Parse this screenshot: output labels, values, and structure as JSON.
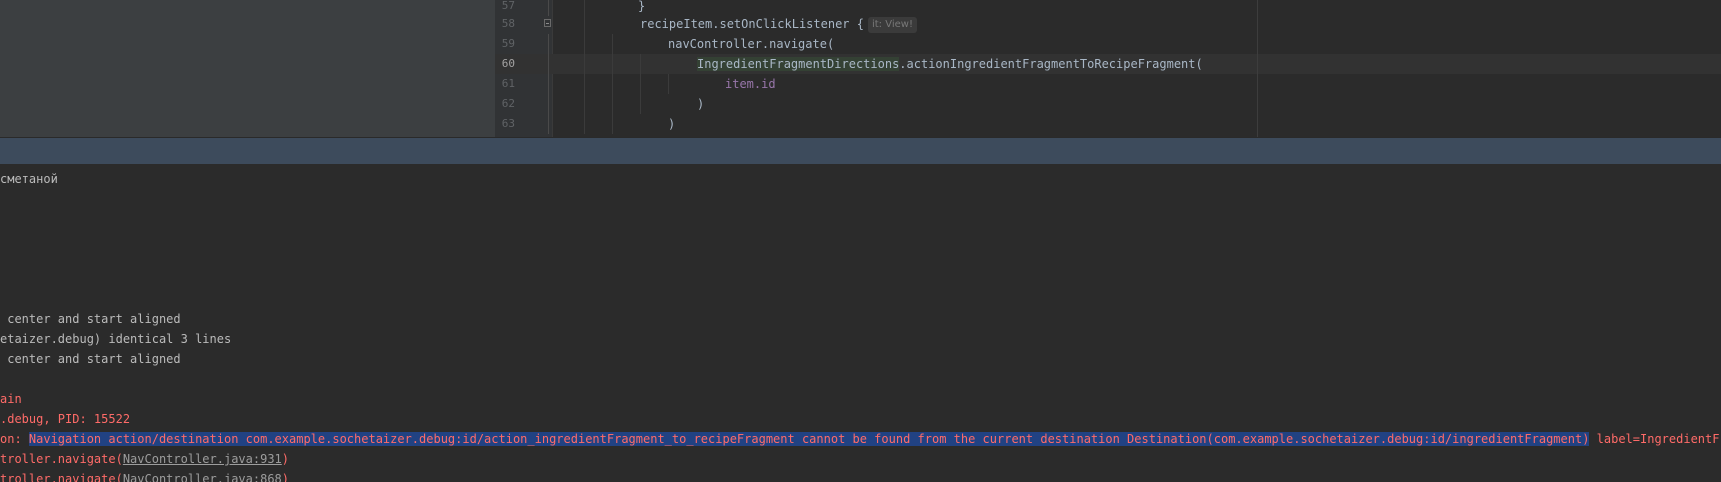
{
  "editor": {
    "lines": [
      {
        "no": "57",
        "text": "}"
      },
      {
        "no": "58",
        "text": "recipeItem.setOnClickListener {",
        "hint": "it: View!"
      },
      {
        "no": "59",
        "text": "navController.navigate("
      },
      {
        "no": "60",
        "class_name": "IngredientFragmentDirections",
        "text": ".actionIngredientFragmentToRecipeFragment("
      },
      {
        "no": "61",
        "text": "item.id"
      },
      {
        "no": "62",
        "text": ")"
      },
      {
        "no": "63",
        "text": ")"
      }
    ]
  },
  "logcat": {
    "lines": [
      {
        "text": "сметаной",
        "level": "info"
      },
      {
        "text": " center and start aligned",
        "level": "info"
      },
      {
        "text": "etaizer.debug) identical 3 lines",
        "level": "info"
      },
      {
        "text": " center and start aligned",
        "level": "info"
      },
      {
        "text": "ain",
        "level": "error"
      },
      {
        "text": ".debug, PID: 15522",
        "level": "error"
      },
      {
        "prefix": "on: ",
        "selected": "Navigation action/destination com.example.sochetaizer.debug:id/action_ingredientFragment_to_recipeFragment cannot be found from the current destination Destination(com.example.sochetaizer.debug:id/ingredientFragment)",
        "suffix": " label=IngredientFragment",
        "level": "error"
      },
      {
        "prefix": "troller.navigate(",
        "link": "NavController.java:931",
        "suffix": ")",
        "level": "error"
      },
      {
        "prefix": "troller.navigate(",
        "link": "NavController.java:868",
        "suffix": ")",
        "level": "error"
      }
    ]
  },
  "colors": {
    "editor_bg": "#2b2b2b",
    "project_panel_bg": "#3c3f41",
    "tool_header_bg": "#3d4b5c",
    "error_text": "#ff6b68",
    "selection_bg": "#214283"
  }
}
